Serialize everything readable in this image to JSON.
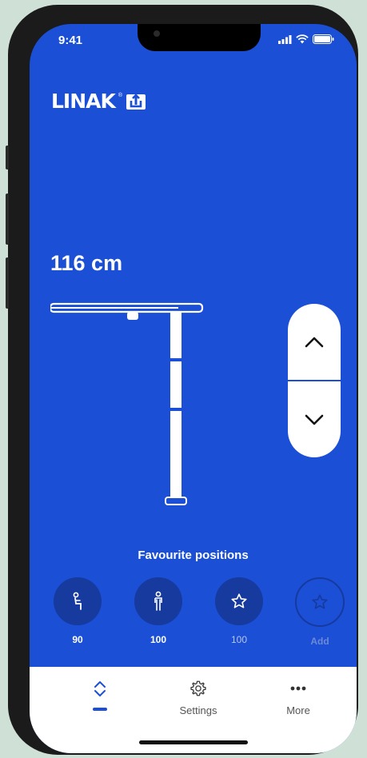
{
  "status_bar": {
    "time": "9:41"
  },
  "brand": {
    "name": "LINAK",
    "registered": "®"
  },
  "desk": {
    "height_text": "116 cm"
  },
  "controls": {
    "up_icon": "chevron-up-icon",
    "down_icon": "chevron-down-icon"
  },
  "favourites": {
    "title": "Favourite positions",
    "items": [
      {
        "icon": "sitting-person-icon",
        "value": "90"
      },
      {
        "icon": "standing-person-icon",
        "value": "100"
      },
      {
        "icon": "star-icon",
        "value": "100"
      },
      {
        "icon": "star-outline-icon",
        "value": "Add"
      }
    ]
  },
  "tabbar": {
    "tabs": [
      {
        "icon": "up-down-chevrons-icon",
        "label": "",
        "active": true
      },
      {
        "icon": "gear-icon",
        "label": "Settings"
      },
      {
        "icon": "more-dots-icon",
        "label": "More"
      }
    ]
  },
  "colors": {
    "primary": "#1a4fd6",
    "dark_circle": "#163a9e",
    "accent": "#1a4fd6"
  }
}
